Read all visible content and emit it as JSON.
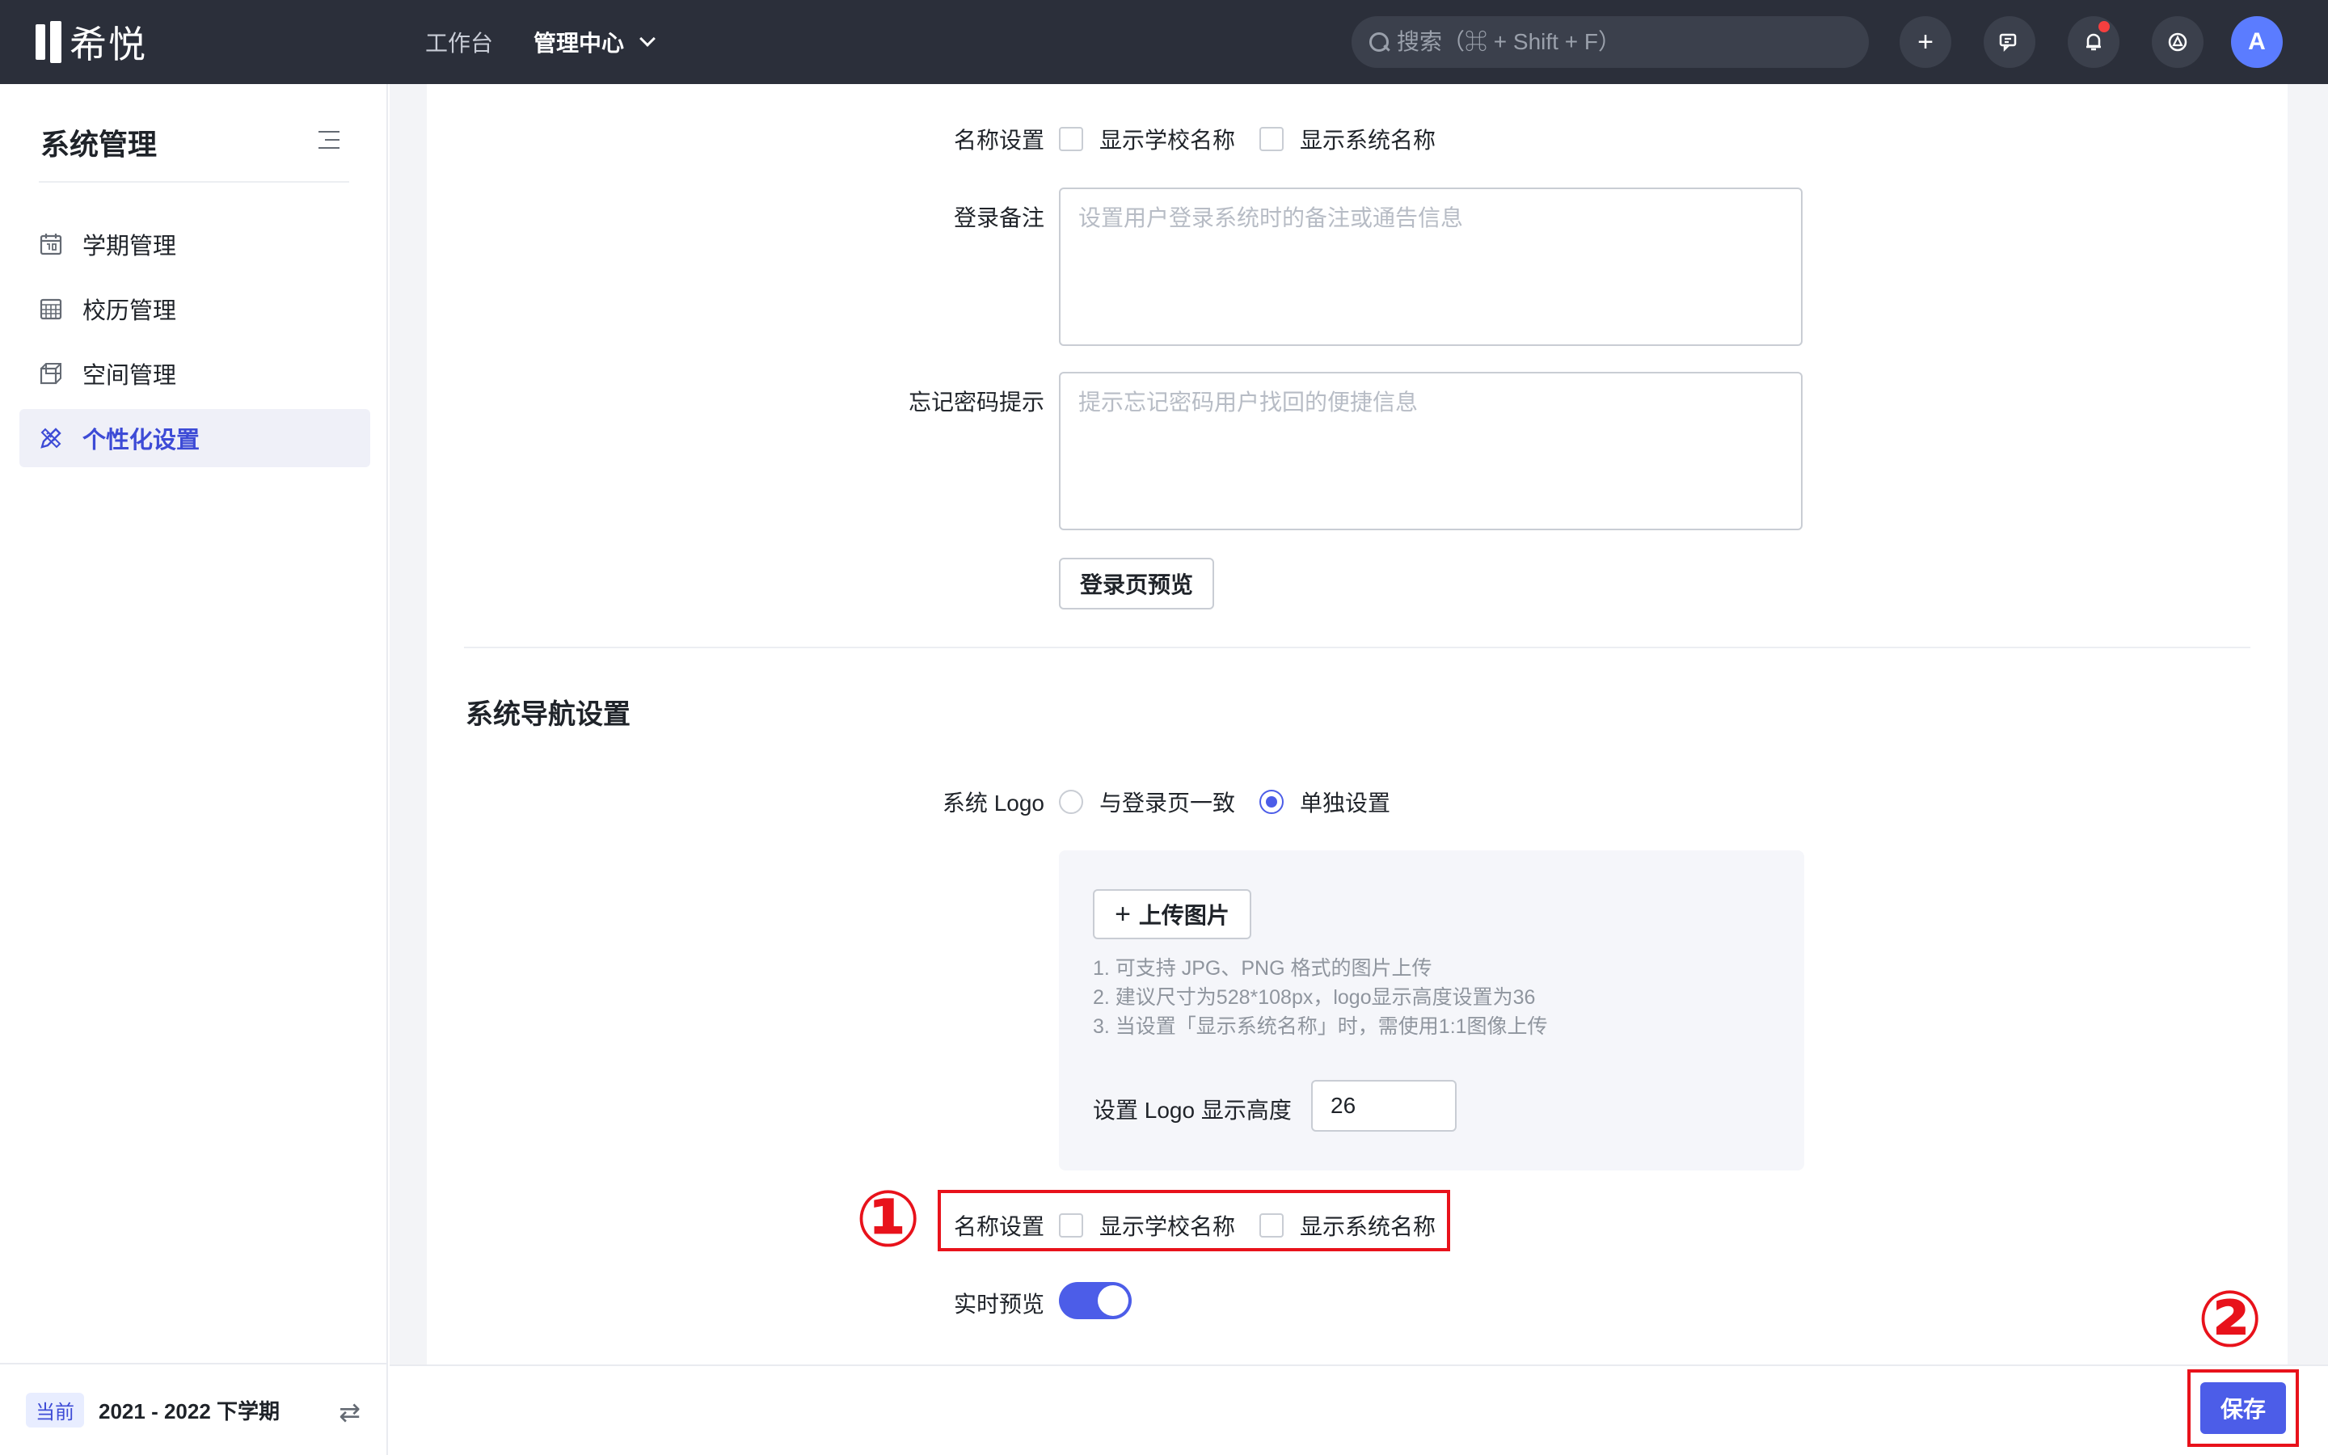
{
  "brand": {
    "name": "希悦"
  },
  "topnav": {
    "workbench": "工作台",
    "admin_center": "管理中心"
  },
  "search": {
    "placeholder": "搜索（⌘ + Shift + F）"
  },
  "topicons": {
    "add": "+",
    "avatar_initial": "A"
  },
  "sidebar": {
    "title": "系统管理",
    "items": [
      {
        "label": "学期管理",
        "icon": "calendar-icon"
      },
      {
        "label": "校历管理",
        "icon": "calendar-grid-icon"
      },
      {
        "label": "空间管理",
        "icon": "cube-icon"
      },
      {
        "label": "个性化设置",
        "icon": "brush-ruler-icon",
        "active": true
      }
    ],
    "footer": {
      "badge": "当前",
      "term": "2021 - 2022 下学期"
    }
  },
  "login": {
    "name_setting_label": "名称设置",
    "show_school_name": "显示学校名称",
    "show_system_name": "显示系统名称",
    "remark_label": "登录备注",
    "remark_placeholder": "设置用户登录系统时的备注或通告信息",
    "forgot_label": "忘记密码提示",
    "forgot_placeholder": "提示忘记密码用户找回的便捷信息",
    "preview_button": "登录页预览"
  },
  "nav_settings": {
    "section_title": "系统导航设置",
    "logo_label": "系统 Logo",
    "logo_option_same": "与登录页一致",
    "logo_option_custom": "单独设置",
    "logo_selected": "单独设置",
    "upload_button": "上传图片",
    "tips": [
      "1. 可支持 JPG、PNG 格式的图片上传",
      "2. 建议尺寸为528*108px，logo显示高度设置为36",
      "3. 当设置「显示系统名称」时，需使用1:1图像上传"
    ],
    "logo_height_label": "设置 Logo 显示高度",
    "logo_height_value": "26",
    "name_setting_label": "名称设置",
    "show_school_name": "显示学校名称",
    "show_system_name": "显示系统名称",
    "live_preview_label": "实时预览",
    "live_preview_on": true
  },
  "annotations": {
    "one": "①",
    "two": "②",
    "color": "#e8121b"
  },
  "footer": {
    "save": "保存"
  },
  "colors": {
    "accent": "#4c5de8",
    "topbar": "#2b2f3a",
    "annotation": "#e8121b"
  }
}
